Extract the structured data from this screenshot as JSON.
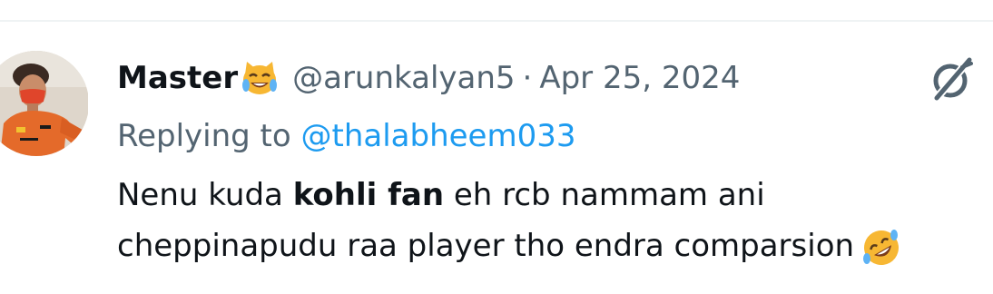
{
  "tweet": {
    "author": {
      "display_name": "Master",
      "name_emoji": "cat-tears-of-joy-emoji",
      "handle": "@arunkalyan5",
      "separator": "·",
      "date": "Apr 25, 2024",
      "avatar": "profile-photo-orange-jersey"
    },
    "reply": {
      "prefix": "Replying to ",
      "to_handle": "@thalabheem033"
    },
    "body": {
      "line1_before": "Nenu kuda ",
      "line1_bold": "kohli fan",
      "line1_after": " eh rcb nammam ani",
      "line2_text": "cheppinapudu raa player tho endra comparsion",
      "trailing_emoji": "rolling-on-floor-laughing-emoji"
    },
    "action_icon": "grok-icon"
  },
  "colors": {
    "text_primary": "#0f1419",
    "text_secondary": "#536471",
    "link": "#1d9bf0",
    "divider": "#eff3f4",
    "background": "#ffffff"
  }
}
